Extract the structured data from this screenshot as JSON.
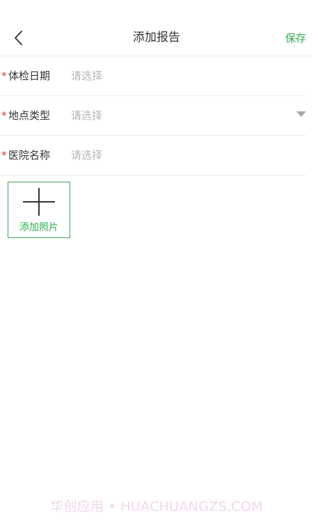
{
  "header": {
    "title": "添加报告",
    "save_label": "保存",
    "back_icon": "chevron-left-icon"
  },
  "form": {
    "required_mark": "*",
    "rows": [
      {
        "label": "体检日期",
        "placeholder": "请选择",
        "has_dropdown": false
      },
      {
        "label": "地点类型",
        "placeholder": "请选择",
        "has_dropdown": true
      },
      {
        "label": "医院名称",
        "placeholder": "请选择",
        "has_dropdown": false
      }
    ]
  },
  "add_photo": {
    "label": "添加照片",
    "icon": "plus-icon"
  },
  "watermark": "华创应用 • HUACHUANGZS.COM",
  "colors": {
    "accent": "#2eab52",
    "required": "#e0353b",
    "placeholder": "#b5b5b5",
    "text": "#333333",
    "divider": "#ececec"
  }
}
